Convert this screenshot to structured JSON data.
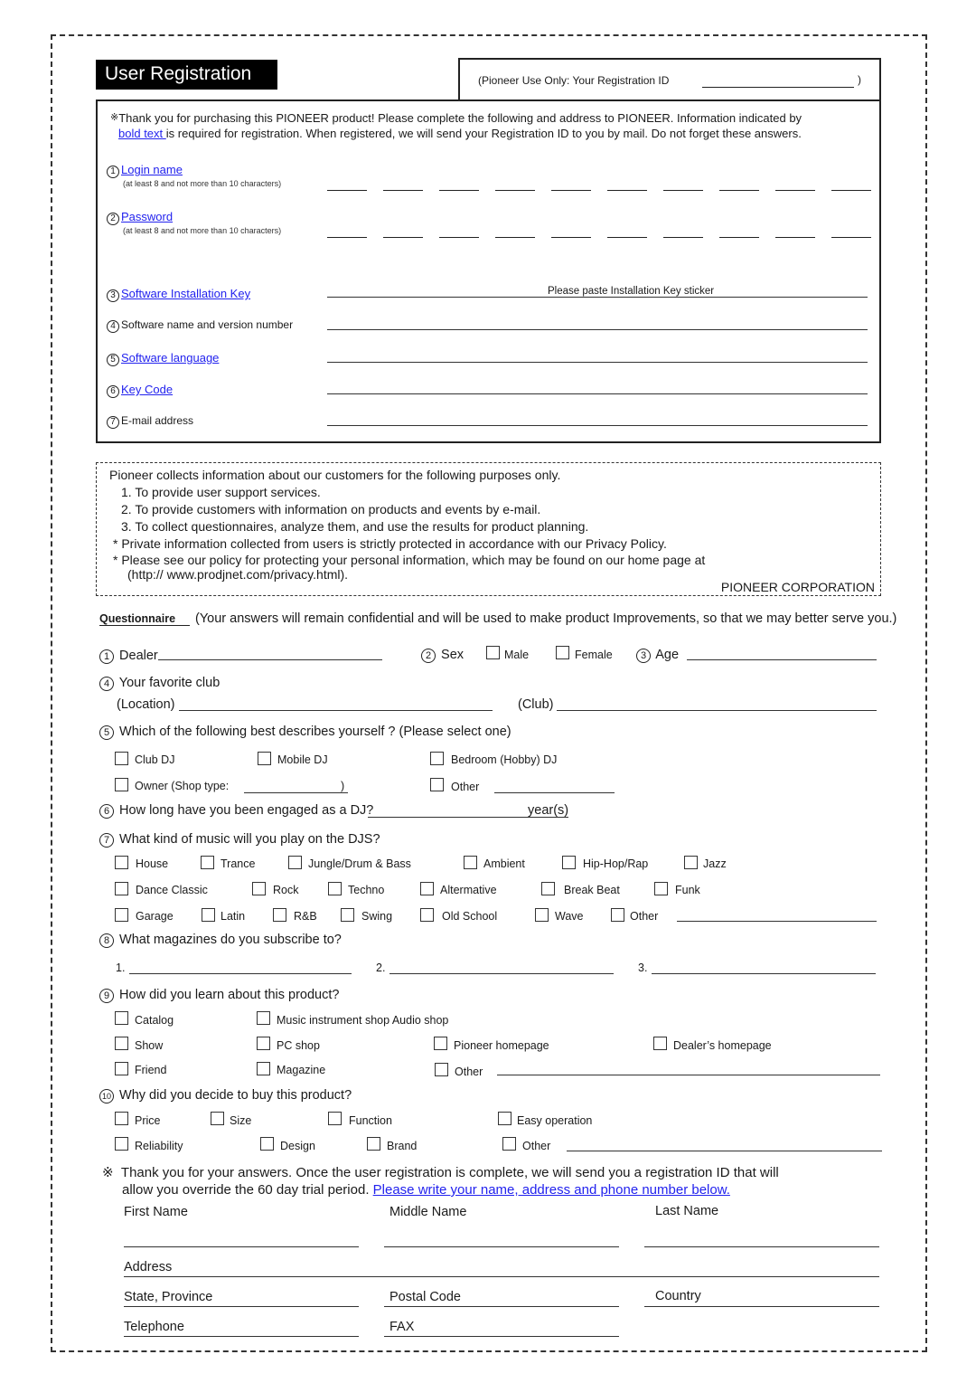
{
  "header": {
    "title": "User Registration",
    "registration_id_label": "(Pioneer Use Only: Your Registration ID",
    "registration_id_close": ")"
  },
  "intro": {
    "mark": "※",
    "text_before_link": "Thank you for purchasing this PIONEER product! Please complete the following and address to PIONEER. Information indicated by",
    "link_text": "bold text ",
    "text_after_link": " is required for registration. When registered, we will send your Registration ID to you by mail. Do not forget these answers."
  },
  "registration_fields": [
    {
      "num": "1",
      "label": "Login name ",
      "required": true,
      "hint": "(at least 8 and not more than 10 characters)"
    },
    {
      "num": "2",
      "label": "Password ",
      "required": true,
      "hint": "(at least 8 and not more than 10 characters)"
    },
    {
      "num": "3",
      "label": "Software Installation Key  ",
      "required": true,
      "line_text": "Please paste Installation Key sticker"
    },
    {
      "num": "4",
      "label": "Software name and version number",
      "required": false
    },
    {
      "num": "5",
      "label": "Software language ",
      "required": true
    },
    {
      "num": "6",
      "label": "Key Code ",
      "required": true
    },
    {
      "num": "7",
      "label": "E-mail address",
      "required": false
    }
  ],
  "privacy": {
    "intro": "Pioneer collects information about our customers for the following purposes only.",
    "items": [
      "1. To provide user support services.",
      "2. To provide customers with information on products and events by e-mail.",
      "3. To collect questionnaires, analyze them, and use the results for product planning."
    ],
    "notes": [
      "* Private information collected from users is strictly protected in accordance with our Privacy Policy.",
      "* Please see our policy for protecting your personal information, which may be found on our home page at"
    ],
    "url": "(http:// www.prodjnet.com/privacy.html).",
    "signature": "PIONEER CORPORATION"
  },
  "questionnaire": {
    "heading": "Questionnaire",
    "subtitle": "(Your answers will remain confidential and will be used to make product Improvements, so that we may better serve you.)",
    "q1": {
      "num": "1",
      "label": "Dealer"
    },
    "q2": {
      "num": "2",
      "label": "Sex",
      "options": [
        "Male",
        "Female"
      ]
    },
    "q3": {
      "num": "3",
      "label": "Age"
    },
    "q4": {
      "num": "4",
      "label": "Your favorite club",
      "location_label": "(Location)",
      "club_label": "(Club)"
    },
    "q5": {
      "num": "5",
      "label": "Which of the following best describes yourself ? (Please select one)",
      "options": [
        "Club DJ",
        "Mobile DJ",
        "Bedroom (Hobby) DJ",
        "Owner (Shop type:",
        "Other"
      ],
      "owner_close": ")"
    },
    "q6": {
      "num": "6",
      "label": "How long have you been engaged as a DJ?",
      "suffix": "year(s)"
    },
    "q7": {
      "num": "7",
      "label": "What kind of music will you play on the DJS?",
      "row1": [
        "House",
        "Trance",
        "Jungle/Drum & Bass",
        "Ambient",
        "Hip-Hop/Rap",
        "Jazz"
      ],
      "row2": [
        "Dance Classic",
        "Rock",
        "Techno",
        "Altermative",
        "Break Beat",
        "Funk"
      ],
      "row3": [
        "Garage",
        "Latin",
        "R&B",
        "Swing",
        "Old School",
        "Wave",
        "Other"
      ]
    },
    "q8": {
      "num": "8",
      "label": "What magazines do you subscribe to?",
      "slots": [
        "1.",
        "2.",
        "3."
      ]
    },
    "q9": {
      "num": "9",
      "label": "How did you learn about this product?",
      "options": [
        "Catalog",
        "Music instrument shop  Audio shop",
        "Show",
        "PC shop",
        "Pioneer homepage",
        "Dealer’s homepage",
        "Friend",
        "Magazine",
        "Other"
      ]
    },
    "q10": {
      "num": "10",
      "label": "Why did you decide to buy this product?",
      "options": [
        "Price",
        "Size",
        "Function",
        "Easy operation",
        "Reliability",
        "Design",
        "Brand",
        "Other"
      ]
    }
  },
  "closing": {
    "mark": "※",
    "line1": "Thank you for your answers. Once the user registration is complete, we will send you a registration ID that will",
    "line2_text": "allow you override the 60 day trial period. ",
    "line2_link": "Please write your name, address and phone number below.   "
  },
  "contact_fields": {
    "first_name": "First Name",
    "middle_name": "Middle Name",
    "last_name": "Last Name",
    "address": "Address",
    "state": "State, Province",
    "postal": "Postal Code",
    "country": "Country",
    "telephone": "Telephone",
    "fax": "FAX"
  },
  "colors": {
    "link": "#2222ee",
    "title_bg": "#000000"
  }
}
